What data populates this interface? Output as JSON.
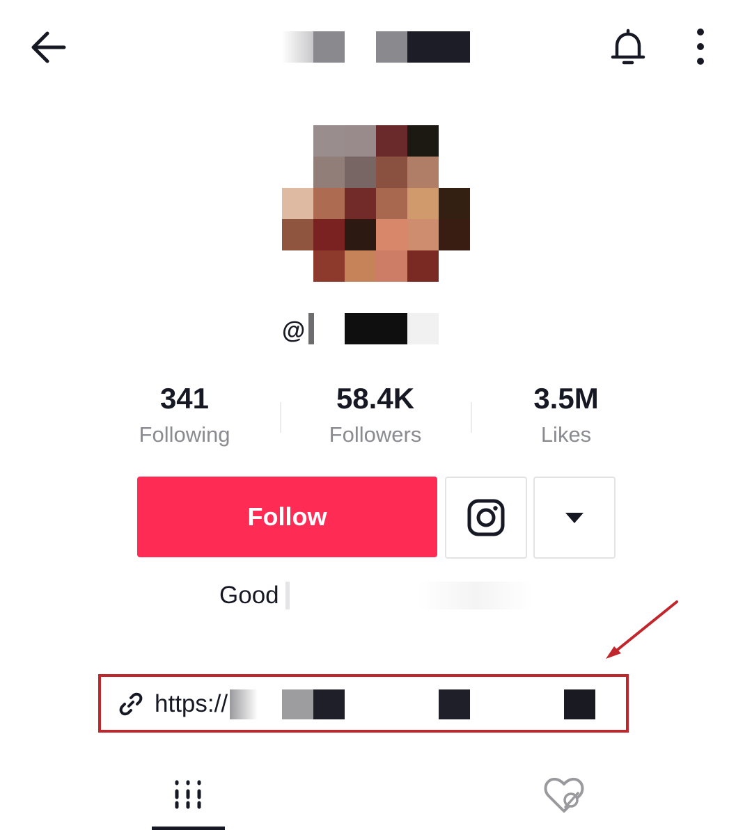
{
  "header": {
    "back_icon": "arrow-left-icon",
    "notification_icon": "bell-icon",
    "more_icon": "vertical-dots-icon"
  },
  "profile": {
    "username_prefix": "@"
  },
  "stats": [
    {
      "value": "341",
      "label": "Following"
    },
    {
      "value": "58.4K",
      "label": "Followers"
    },
    {
      "value": "3.5M",
      "label": "Likes"
    }
  ],
  "actions": {
    "follow_label": "Follow",
    "instagram_icon": "instagram-icon",
    "dropdown_icon": "triangle-down-icon"
  },
  "bio": {
    "text": "Good"
  },
  "link": {
    "icon": "link-icon",
    "text": "https://"
  },
  "tabs": [
    {
      "icon": "grid-icon",
      "selected": true
    },
    {
      "icon": "liked-hidden-icon",
      "selected": false
    }
  ],
  "colors": {
    "accent": "#fe2c55",
    "annotation": "#c0262c",
    "text_primary": "#161823",
    "text_secondary": "#8a8b91"
  }
}
